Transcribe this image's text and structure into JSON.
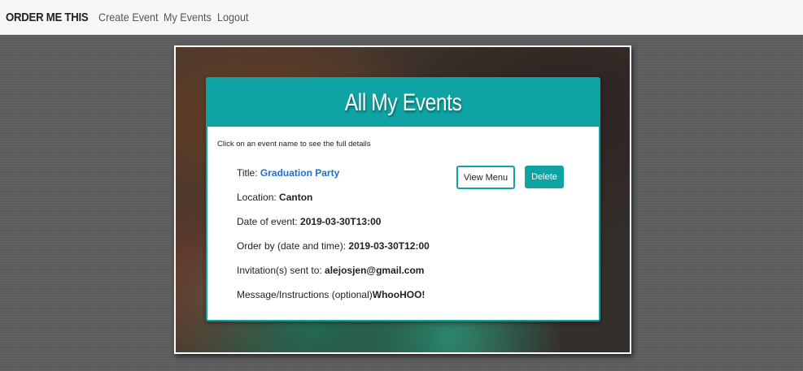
{
  "nav": {
    "brand": "ORDER ME THIS",
    "links": [
      "Create Event",
      "My Events",
      "Logout"
    ]
  },
  "card": {
    "title": "All My Events",
    "hint": "Click on an event name to see the full details",
    "event": {
      "title_label": "Title: ",
      "title_value": "Graduation Party",
      "location_label": "Location: ",
      "location_value": "Canton",
      "date_label": "Date of event: ",
      "date_value": "2019-03-30T13:00",
      "order_label": "Order by (date and time): ",
      "order_value": "2019-03-30T12:00",
      "invite_label": "Invitation(s) sent to: ",
      "invite_value": "alejosjen@gmail.com",
      "message_label": "Message/Instructions (optional)",
      "message_value": "WhooHOO!"
    },
    "buttons": {
      "view_menu": "View Menu",
      "delete": "Delete"
    }
  },
  "colors": {
    "accent": "#0fa3a3",
    "link": "#1a6fd6"
  }
}
